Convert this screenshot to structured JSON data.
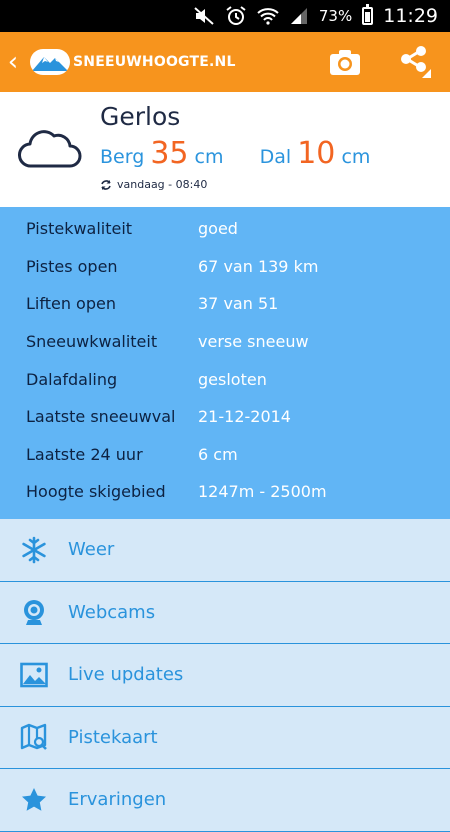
{
  "status": {
    "battery": "73%",
    "time": "11:29"
  },
  "appbar": {
    "logo_text": "SNEEUWHOOGTE.NL"
  },
  "resort": {
    "name": "Gerlos",
    "mountain_label": "Berg",
    "mountain_value": "35",
    "valley_label": "Dal",
    "valley_value": "10",
    "unit": "cm",
    "updated": "vandaag - 08:40"
  },
  "stats": [
    {
      "label": "Pistekwaliteit",
      "value": "goed"
    },
    {
      "label": "Pistes open",
      "value": "67 van 139 km"
    },
    {
      "label": "Liften open",
      "value": "37 van 51"
    },
    {
      "label": "Sneeuwkwaliteit",
      "value": "verse sneeuw"
    },
    {
      "label": "Dalafdaling",
      "value": "gesloten"
    },
    {
      "label": "Laatste sneeuwval",
      "value": "21-12-2014"
    },
    {
      "label": "Laatste 24 uur",
      "value": "6 cm"
    },
    {
      "label": "Hoogte skigebied",
      "value": "1247m - 2500m"
    }
  ],
  "menu": [
    {
      "label": "Weer",
      "icon": "snowflake-icon"
    },
    {
      "label": "Webcams",
      "icon": "webcam-icon"
    },
    {
      "label": "Live updates",
      "icon": "image-icon"
    },
    {
      "label": "Pistekaart",
      "icon": "map-icon"
    },
    {
      "label": "Ervaringen",
      "icon": "star-icon"
    }
  ],
  "colors": {
    "brand_orange": "#f7941d",
    "stats_blue": "#61b5f5",
    "accent_blue": "#2a93dc",
    "value_orange": "#f26522"
  }
}
